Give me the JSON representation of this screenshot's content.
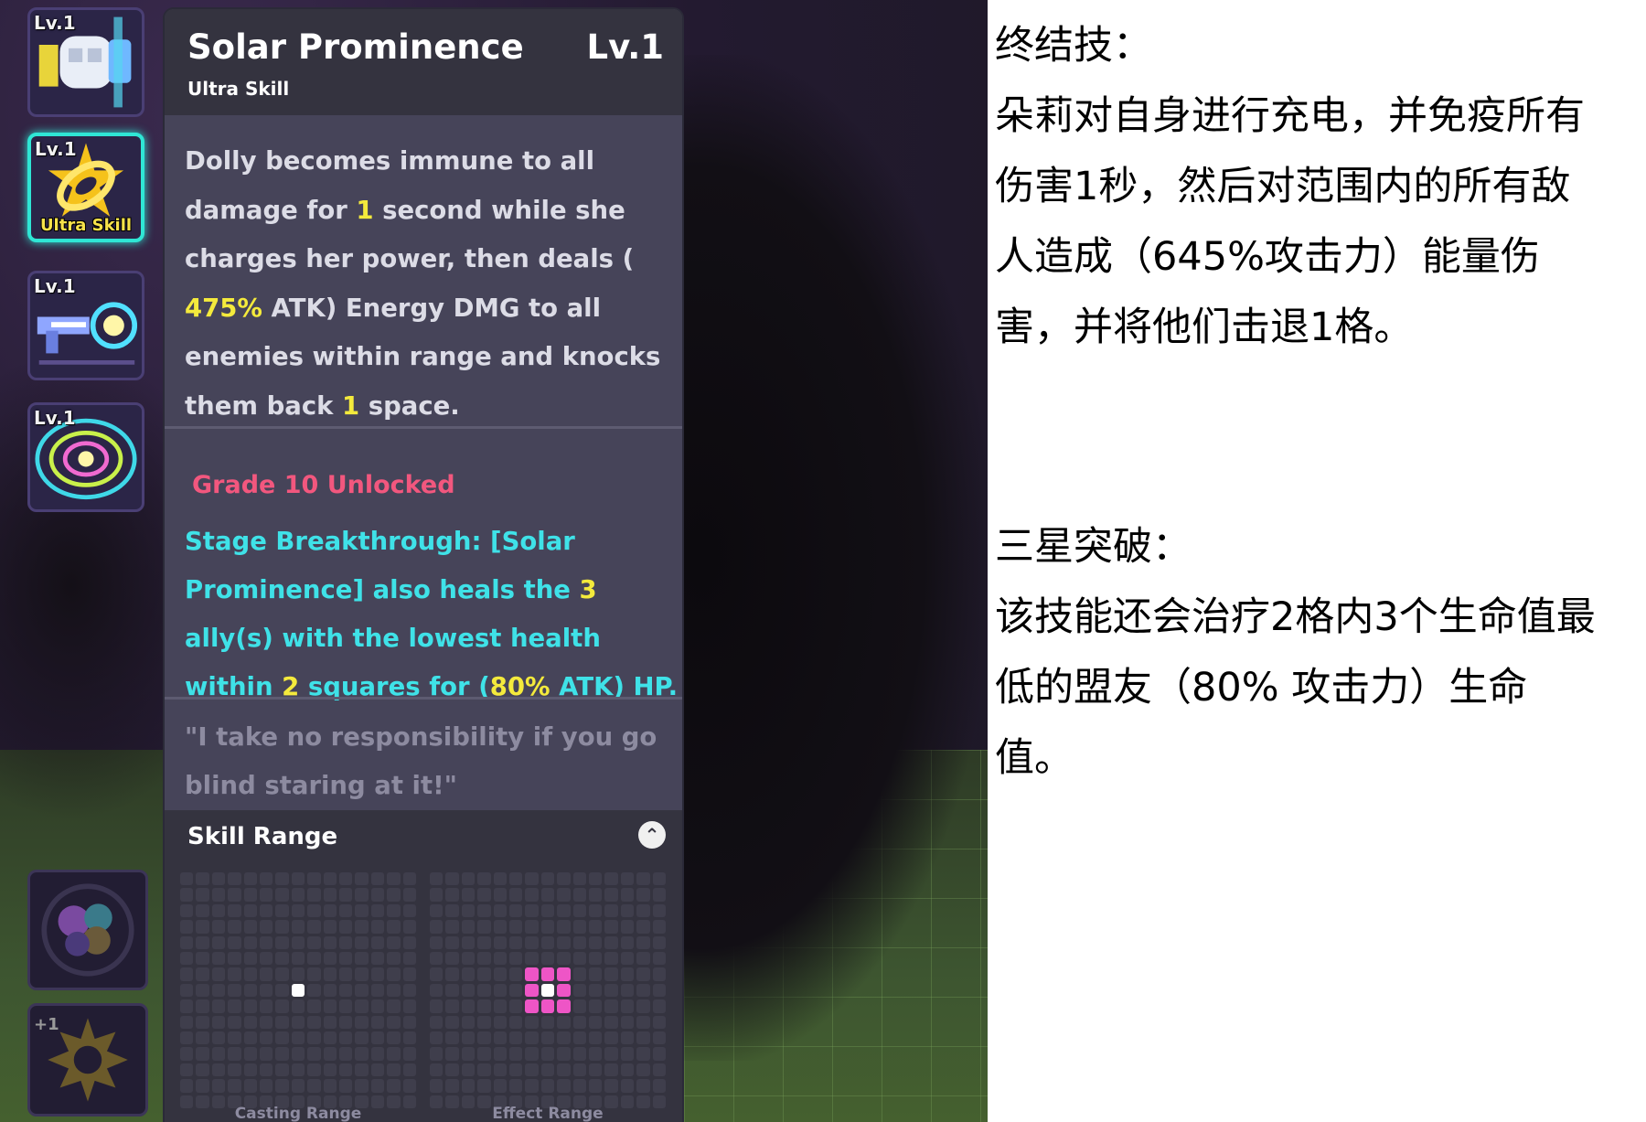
{
  "skills": {
    "icons": [
      {
        "level": "Lv.1",
        "name": "skill-1"
      },
      {
        "level": "Lv.1",
        "name": "skill-ultra",
        "label": "Ultra Skill"
      },
      {
        "level": "Lv.1",
        "name": "skill-3"
      },
      {
        "level": "Lv.1",
        "name": "skill-4"
      }
    ],
    "passive_plus": "+1"
  },
  "tooltip": {
    "title": "Solar Prominence",
    "level": "Lv.1",
    "subtitle": "Ultra Skill",
    "description": {
      "p1": "Dolly becomes immune to all damage for ",
      "v1": "1",
      "p2": " second while she charges her power, then deals ( ",
      "v2": "475%",
      "p3": " ATK) Energy DMG to all enemies within range and knocks them back ",
      "v3": "1",
      "p4": " space."
    },
    "unlock_title": "Grade 10 Unlocked",
    "breakthrough": {
      "p1": "Stage Breakthrough: [Solar Prominence] also heals the ",
      "v1": "3",
      "p2": " ally(s) with the lowest health within ",
      "v2": "2",
      "p3": " squares for (",
      "v3": "80%",
      "p4": " ATK) HP."
    },
    "quote": "\"I take no responsibility if you go blind staring at it!\"",
    "range": {
      "title": "Skill Range",
      "casting_label": "Casting Range",
      "effect_label": "Effect Range"
    }
  },
  "translation": {
    "section1_title": "终结技：",
    "section1_lines": [
      "朵莉对自身进行充电，并免疫所有",
      "伤害1秒，然后对范围内的所有敌",
      "人造成（645%攻击力）能量伤",
      "害，并将他们击退1格。"
    ],
    "section2_title": "三星突破：",
    "section2_lines": [
      "该技能还会治疗2格内3个生命值最",
      "低的盟友（80% 攻击力）生命",
      "值。"
    ]
  }
}
